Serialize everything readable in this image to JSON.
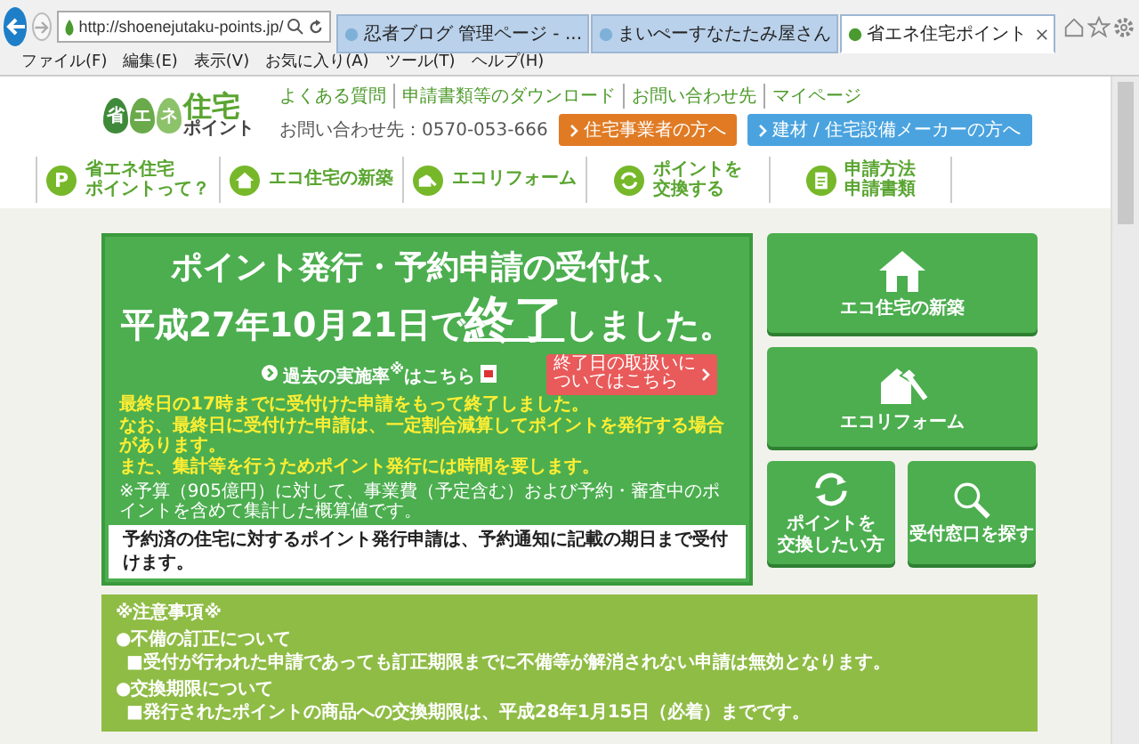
{
  "browser": {
    "url": "http://shoenejutaku-points.jp/",
    "tabs": [
      {
        "title": "忍者ブログ 管理ページ - ...",
        "selected": false
      },
      {
        "title": "まいぺーすなたたみ屋さん",
        "selected": false
      },
      {
        "title": "省エネ住宅ポイント",
        "selected": true
      }
    ],
    "menu": [
      "ファイル(F)",
      "編集(E)",
      "表示(V)",
      "お気に入り(A)",
      "ツール(T)",
      "ヘルプ(H)"
    ]
  },
  "header": {
    "logo": {
      "leaves": [
        "省",
        "エ",
        "ネ"
      ],
      "main": "住宅",
      "sub": "ポイント"
    },
    "links": [
      "よくある質問",
      "申請書類等のダウンロード",
      "お問い合わせ先",
      "マイページ"
    ],
    "phone": "お問い合わせ先：0570-053-666",
    "buttons": [
      {
        "label": "住宅事業者の方へ",
        "color": "#e07b24"
      },
      {
        "label": "建材 / 住宅設備メーカーの方へ",
        "color": "#4aa3df"
      }
    ]
  },
  "nav": [
    {
      "kind": "letter",
      "badge": "P",
      "lines": [
        "省エネ住宅",
        "ポイントって？"
      ]
    },
    {
      "kind": "house",
      "lines": [
        "エコ住宅の新築"
      ]
    },
    {
      "kind": "reform",
      "lines": [
        "エコリフォーム"
      ]
    },
    {
      "kind": "exchange",
      "lines": [
        "ポイントを",
        "交換する"
      ]
    },
    {
      "kind": "document",
      "lines": [
        "申請方法",
        "申請書類"
      ]
    }
  ],
  "notice": {
    "title": "ポイント発行・予約申請の受付は、",
    "headline": {
      "before": "平成27年10月21日で",
      "emphasis": "終了",
      "after": "しました。"
    },
    "link": "過去の実施率$^{※}$はこちら",
    "end_button": [
      "終了日の取扱いに",
      "ついてはこちら"
    ],
    "details": [
      "最終日の17時までに受付けた申請をもって終了しました。",
      "なお、最終日に受付けた申請は、一定割合減算してポイントを発行する場合があります。",
      "また、集計等を行うためポイント発行には時間を要します。"
    ],
    "footnote": "※予算（905億円）に対して、事業費（予定含む）および予約・審査中のポイントを含めて集計した概算値です。",
    "footer": "予約済の住宅に対するポイント発行申請は、予約通知に記載の期日まで受付けます。"
  },
  "large_tiles": [
    {
      "kind": "house",
      "lines": [
        "エコ住宅の新築"
      ]
    },
    {
      "kind": "reform",
      "lines": [
        "エコリフォーム"
      ]
    }
  ],
  "small_tiles": [
    {
      "kind": "exchange",
      "lines": [
        "ポイントを",
        "交換したい方"
      ]
    },
    {
      "kind": "search",
      "lines": [
        "受付窓口を探す"
      ]
    }
  ],
  "cautions": {
    "title": "※注意事項※",
    "sections": [
      {
        "heading": "●不備の訂正について",
        "items": [
          "■受付が行われた申請であっても訂正期限までに不備等が解消されない申請は無効となります。"
        ]
      },
      {
        "heading": "●交換期限について",
        "items": [
          "■発行されたポイントの商品への交換期限は、平成28年1月15日（必着）までです。"
        ]
      }
    ]
  }
}
